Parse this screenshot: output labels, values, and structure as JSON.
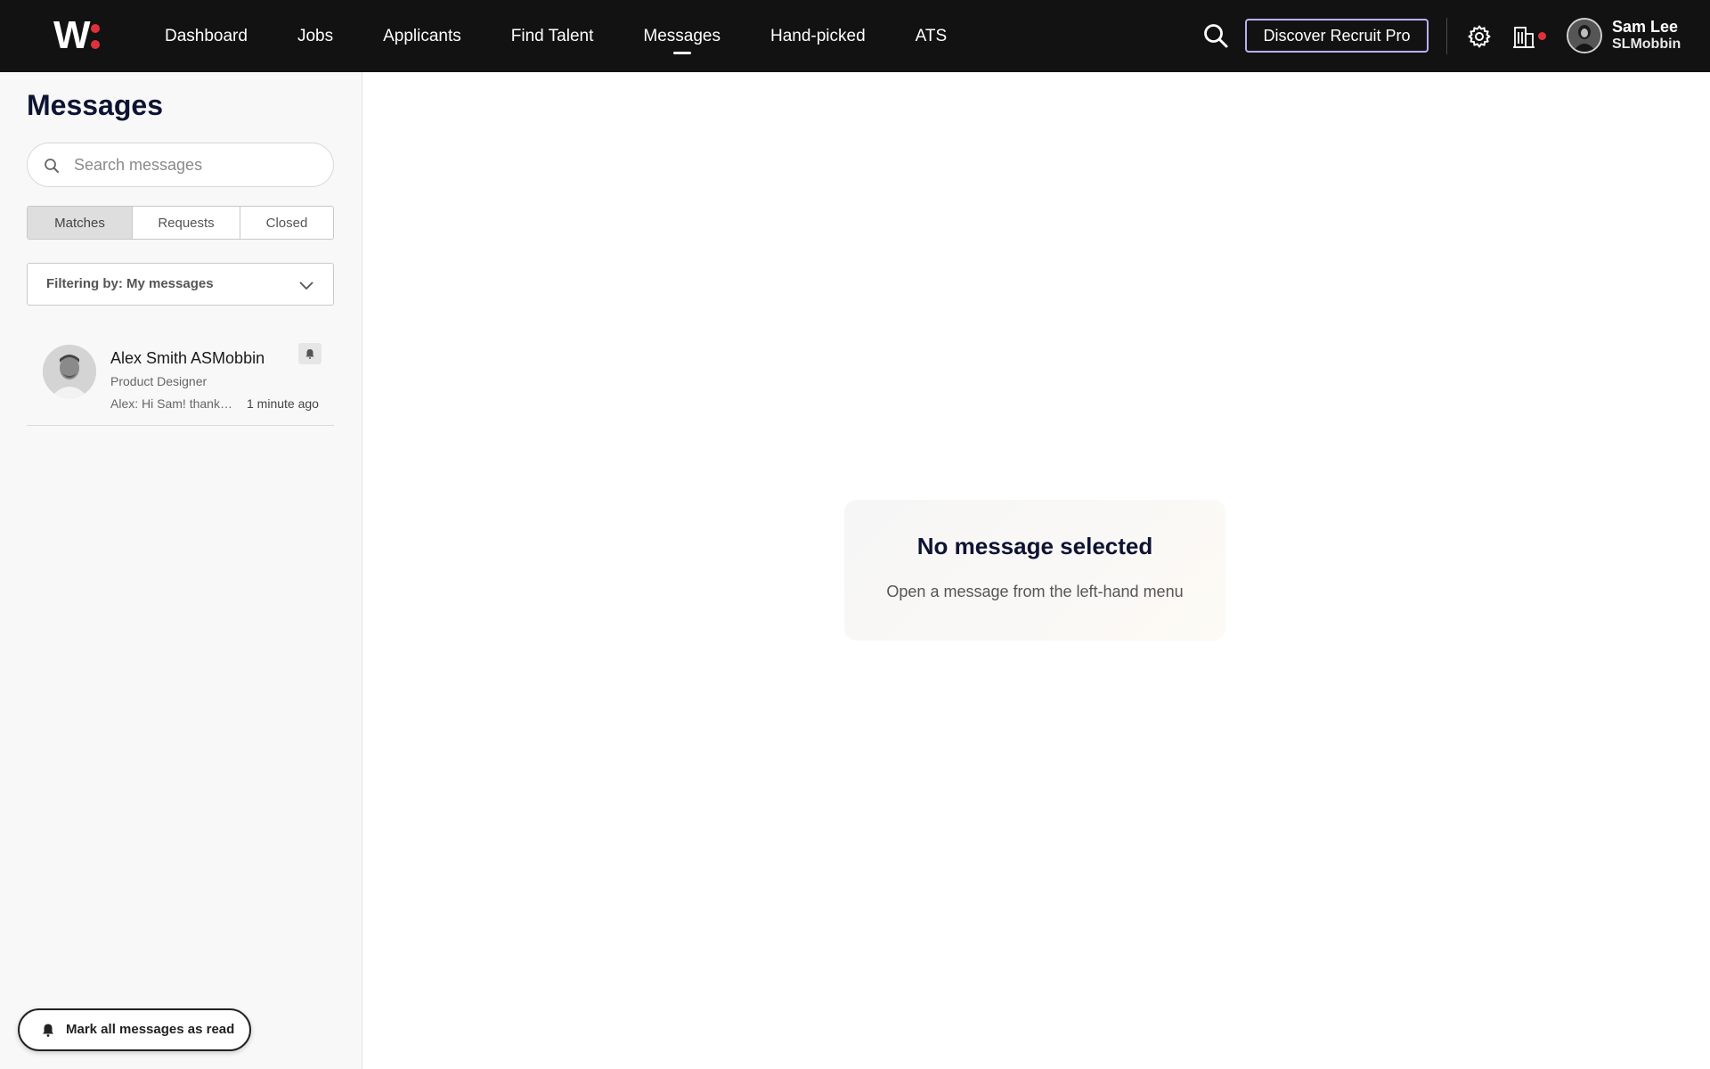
{
  "nav": {
    "brand": "W:",
    "links": [
      {
        "label": "Dashboard",
        "active": false
      },
      {
        "label": "Jobs",
        "active": false
      },
      {
        "label": "Applicants",
        "active": false
      },
      {
        "label": "Find Talent",
        "active": false
      },
      {
        "label": "Messages",
        "active": true
      },
      {
        "label": "Hand-picked",
        "active": false
      },
      {
        "label": "ATS",
        "active": false
      }
    ],
    "cta_label": "Discover Recruit Pro",
    "user": {
      "name": "Sam Lee",
      "org": "SLMobbin"
    },
    "icons": [
      "search-icon",
      "gear-icon",
      "building-icon",
      "notification-dot"
    ]
  },
  "sidebar": {
    "title": "Messages",
    "search_placeholder": "Search messages",
    "tabs": [
      {
        "label": "Matches",
        "active": true
      },
      {
        "label": "Requests",
        "active": false
      },
      {
        "label": "Closed",
        "active": false
      }
    ],
    "filter_label": "Filtering by: My messages",
    "conversations": [
      {
        "name": "Alex Smith ASMobbin",
        "role": "Product Designer",
        "preview": "Alex: Hi Sam! thanks for reaching out",
        "time": "1 minute ago"
      }
    ],
    "mark_all_label": "Mark all messages as read"
  },
  "main": {
    "empty_title": "No message selected",
    "empty_subtitle": "Open a message from the left-hand menu"
  },
  "colors": {
    "nav_bg": "#121212",
    "accent_red": "#e0313b",
    "cta_border": "#b9b0f0",
    "sidebar_bg": "#f8f8f8",
    "heading": "#0e1333"
  }
}
